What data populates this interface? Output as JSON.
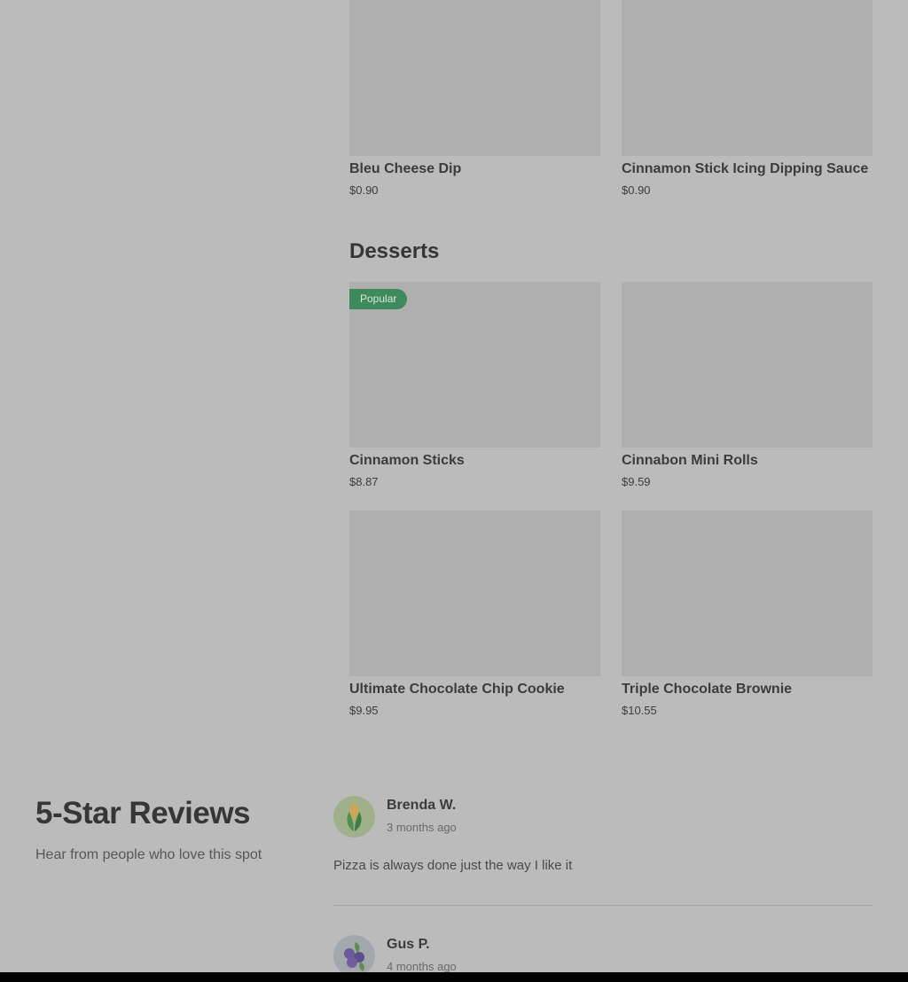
{
  "menu": {
    "top_items": [
      {
        "name": "Bleu Cheese Dip",
        "price": "$0.90"
      },
      {
        "name": "Cinnamon Stick Icing Dipping Sauce",
        "price": "$0.90"
      }
    ],
    "desserts": {
      "title": "Desserts",
      "items": [
        {
          "name": "Cinnamon Sticks",
          "price": "$8.87",
          "badge": "Popular"
        },
        {
          "name": "Cinnabon Mini Rolls",
          "price": "$9.59"
        },
        {
          "name": "Ultimate Chocolate Chip Cookie",
          "price": "$9.95"
        },
        {
          "name": "Triple Chocolate Brownie",
          "price": "$10.55"
        }
      ]
    }
  },
  "reviews": {
    "title": "5-Star Reviews",
    "subtitle": "Hear from people who love this spot",
    "items": [
      {
        "name": "Brenda W.",
        "date": "3 months ago",
        "text": "Pizza is always done just the way I like it",
        "avatar_icon": "corn-icon"
      },
      {
        "name": "Gus P.",
        "date": "4 months ago",
        "text": "",
        "avatar_icon": "blueberry-icon"
      }
    ]
  },
  "colors": {
    "background": "#bbbbbb",
    "image_placeholder": "#afafaf",
    "badge": "#3f8a5c"
  }
}
